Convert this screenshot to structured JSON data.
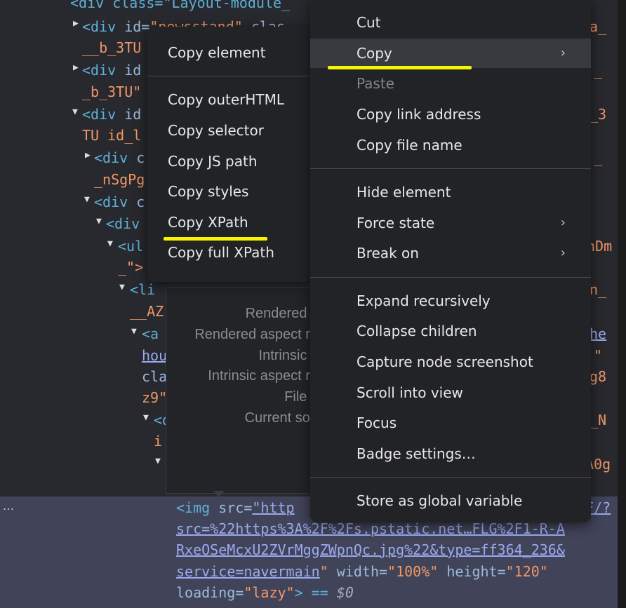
{
  "code_lines": {
    "l0": "<div class=\"Layout-module_",
    "l1_tag": "<div",
    "l1_attr": " id=",
    "l1_val": "\"newsstand\"",
    "l1_rest": " clas",
    "l1b": "__b_3TU",
    "l2_tag": "<div",
    "l2_attr": " id",
    "l2b": "_b_3TU\"",
    "l3_tag": "<div",
    "l3_attr": " id",
    "l3b": "TU id_l",
    "l4_tag": "<div",
    "l4_attr": " c",
    "l4b": "_nSgPg",
    "l5_tag": "<div",
    "l5_attr": " c",
    "l6_tag": "<div",
    "l7_tag": "<ul",
    "l7b": "_\">",
    "l8_tag": "<li",
    "l8b": "__AZ",
    "l9_tag": "<a",
    "l9b": "hou",
    "l9c": "cla",
    "l9d": "z9\"",
    "l10": "<d",
    "l10b": "i",
    "right_a": "a_",
    "right_b": "_",
    "right_c": "_3",
    "right_d": "_",
    "right_e": "nDm",
    "right_f": "n_",
    "right_g": "he",
    "right_h": "\"",
    "right_i": "g8",
    "right_j": "_N",
    "right_k": "A0g",
    "img_tag": "<img",
    "img_attr_src": " src=",
    "img_http": "\"http",
    "img_right": "F/?",
    "img_line2": "src=%22https%3A%2F%2Fs.pstatic.net…FLG%2F1-R-A",
    "img_line3": "RxeOSeMcxU2ZVrMggZWpnQc.jpg%22&type=ff364_236&",
    "img_line4a": "service=navermain",
    "img_line4b": "\"",
    "img_width_attr": " width=",
    "img_width_val": "\"100%\"",
    "img_height_attr": " height=",
    "img_height_val": "\"120\"",
    "img_loading_attr": "loading=",
    "img_loading_val": "\"lazy\"",
    "img_end": "> == ",
    "img_var": "$0",
    "ellipsis": "…"
  },
  "tooltip": {
    "rendered_size": "Rendered s",
    "rendered_aspect": "Rendered aspect ra",
    "intrinsic_size": "Intrinsic s",
    "intrinsic_aspect": "Intrinsic aspect ra",
    "file_size": "File s",
    "current_source": "Current sou"
  },
  "submenu": {
    "copy_element": "Copy element",
    "copy_outerhtml": "Copy outerHTML",
    "copy_selector": "Copy selector",
    "copy_js_path": "Copy JS path",
    "copy_styles": "Copy styles",
    "copy_xpath": "Copy XPath",
    "copy_full_xpath": "Copy full XPath"
  },
  "context_menu": {
    "cut": "Cut",
    "copy": "Copy",
    "paste": "Paste",
    "copy_link_address": "Copy link address",
    "copy_file_name": "Copy file name",
    "hide_element": "Hide element",
    "force_state": "Force state",
    "break_on": "Break on",
    "expand_recursively": "Expand recursively",
    "collapse_children": "Collapse children",
    "capture_node_screenshot": "Capture node screenshot",
    "scroll_into_view": "Scroll into view",
    "focus": "Focus",
    "badge_settings": "Badge settings…",
    "store_as_global_variable": "Store as global variable",
    "submenu_chevron": "›"
  },
  "colors": {
    "highlight": "#f8f500",
    "tag": "#5db0d7",
    "attr_value": "#f29766",
    "selected_row": "#414459"
  }
}
